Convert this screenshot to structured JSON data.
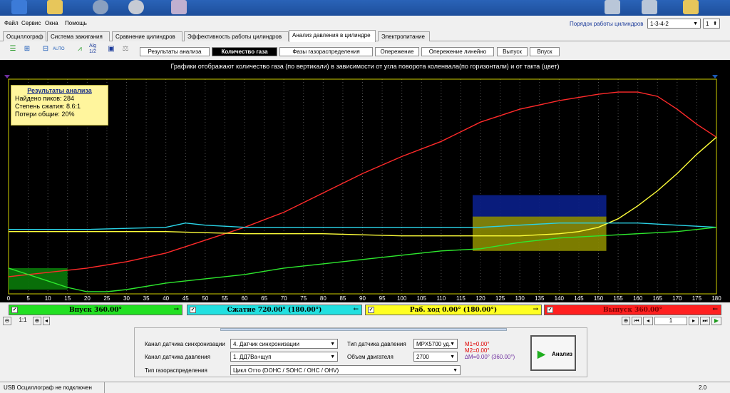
{
  "menu": {
    "items": [
      "Файл",
      "Сервис",
      "Окна",
      "Помощь"
    ]
  },
  "cylinder_order": {
    "label": "Порядок работы цилиндров",
    "value": "1-3-4-2",
    "cylinder": "1"
  },
  "main_tabs": [
    "Осциллограф",
    "Система зажигания",
    "Сравнение цилиндров",
    "Эффективность работы цилиндров",
    "Анализ давления в цилиндре",
    "Электропитание"
  ],
  "main_tab_active": 4,
  "toolbar_icons": [
    "tb-lines-icon",
    "tb-layout-icon",
    "tb-scale-icon",
    "tb-auto-icon",
    "tb-graph-icon",
    "tb-algorithm-icon",
    "save-icon",
    "scales-icon"
  ],
  "toolbar_text": {
    "auto": "AUTO",
    "alg": "Alg",
    "alg_sub": "1/2"
  },
  "sub_tabs": [
    "Результаты анализа",
    "Количество газа",
    "Фазы газораспределения",
    "Опережение",
    "Опережение линейно",
    "Выпуск",
    "Впуск"
  ],
  "sub_tab_active": 1,
  "chart_title": "Графики отображают количество газа (по вертикали) в зависимости от угла поворота коленвала(по горизонтали) и от такта (цвет)",
  "analysis_box": {
    "title": "Результаты анализа",
    "lines": [
      "Найдено пиков: 284",
      "Степень сжатия: 8.6:1",
      "Потери общие: 20%"
    ]
  },
  "chart_data": {
    "type": "line",
    "x_ticks": [
      0,
      5,
      10,
      15,
      20,
      25,
      30,
      35,
      40,
      45,
      50,
      55,
      60,
      65,
      70,
      75,
      80,
      85,
      90,
      95,
      100,
      105,
      110,
      115,
      120,
      125,
      130,
      135,
      140,
      145,
      150,
      155,
      160,
      165,
      170,
      175,
      180
    ],
    "xlim": [
      0,
      180
    ],
    "ylim": [
      0,
      100
    ],
    "grid": "vertical dotted",
    "series": [
      {
        "color": "#ff2a2a",
        "x": [
          0,
          10,
          20,
          30,
          40,
          50,
          60,
          70,
          80,
          90,
          100,
          110,
          120,
          130,
          140,
          150,
          155,
          160,
          165,
          170,
          175,
          180
        ],
        "y": [
          8,
          10,
          12,
          15,
          19,
          25,
          31,
          38,
          47,
          56,
          64,
          71,
          80,
          86,
          90,
          93,
          94,
          94,
          92,
          86,
          79,
          73
        ]
      },
      {
        "color": "#ffff3a",
        "x": [
          0,
          20,
          40,
          60,
          80,
          100,
          120,
          130,
          140,
          145,
          150,
          155,
          160,
          165,
          170,
          175,
          180
        ],
        "y": [
          29,
          29,
          29,
          28,
          28,
          27,
          27,
          27,
          28,
          29,
          31,
          35,
          41,
          48,
          56,
          65,
          73
        ]
      },
      {
        "color": "#2ad4e8",
        "x": [
          0,
          20,
          40,
          45,
          50,
          60,
          80,
          100,
          120,
          140,
          160,
          170,
          180
        ],
        "y": [
          30,
          30,
          31,
          33,
          32,
          31,
          31,
          31,
          31,
          33,
          33,
          32,
          31
        ]
      },
      {
        "color": "#2ee82e",
        "x": [
          0,
          10,
          15,
          20,
          25,
          30,
          40,
          50,
          60,
          70,
          80,
          90,
          100,
          110,
          120,
          130,
          140,
          150,
          160,
          170,
          180
        ],
        "y": [
          12,
          6,
          3,
          1,
          1,
          2,
          5,
          7,
          9,
          12,
          14,
          16,
          18,
          20,
          21,
          24,
          26,
          27,
          28,
          29,
          31
        ]
      }
    ],
    "regions": [
      {
        "color": "#0a1f8a",
        "x": [
          118,
          152
        ],
        "y": [
          30,
          46
        ]
      },
      {
        "color": "#8a8a00",
        "x": [
          118,
          152
        ],
        "y": [
          20,
          36
        ]
      },
      {
        "color": "#0a7a0a",
        "x": [
          0,
          15
        ],
        "y": [
          2,
          12
        ]
      }
    ]
  },
  "strokes": [
    {
      "label": "Впуск 360.00°",
      "color": "#22e022",
      "arrow": "→",
      "text_color": "#000000"
    },
    {
      "label": "Сжатие 720.00° (180.00°)",
      "color": "#22e0e0",
      "arrow": "←",
      "text_color": "#000000"
    },
    {
      "label": "Раб. ход 0.00° (180.00°)",
      "color": "#ffff22",
      "arrow": "→",
      "text_color": "#000000"
    },
    {
      "label": "Выпуск 360.00°",
      "color": "#ff2020",
      "arrow": "←",
      "text_color": "#7a0000"
    }
  ],
  "nav": {
    "zoom": "1:1",
    "page": "1"
  },
  "settings": {
    "sync_label": "Канал датчика синхронизации",
    "sync_value": "4.  Датчик синхронизации",
    "pressure_label": "Канал датчика давления",
    "pressure_value": "1.  ДД7Ва+щуп",
    "timing_label": "Тип газораспределения",
    "timing_value": "Цикл Отто (DOHC / SOHC / OHC / OHV)",
    "sensor_type_label": "Тип датчика давления",
    "sensor_type_value": "MPX5700 уд.",
    "volume_label": "Объем двигателя",
    "volume_value": "2700"
  },
  "markers": {
    "m1": "M1=0.00°",
    "m2": "M2=0.00°",
    "dm": "∆M=0.00° (360.00°)"
  },
  "analyze_label": "Анализ",
  "status": {
    "text": "USB Осциллограф не подключен",
    "version": "2.0"
  },
  "colors": {
    "chart_bg": "#000000",
    "plot_border": "#d0d000"
  }
}
